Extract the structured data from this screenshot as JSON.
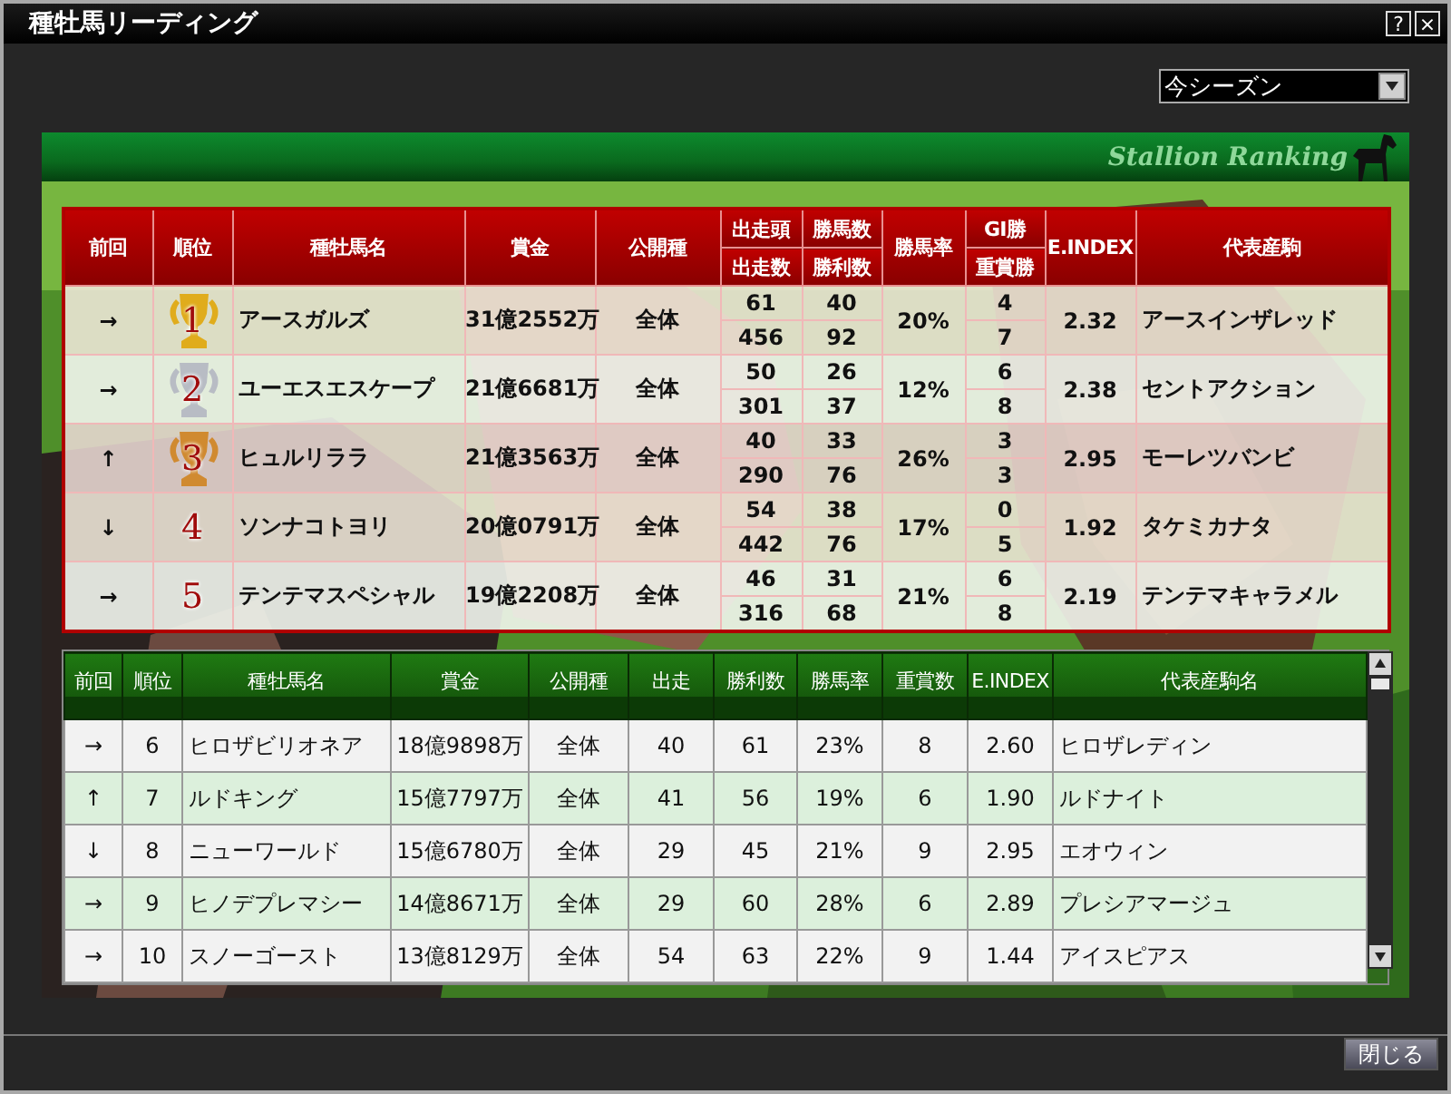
{
  "window": {
    "title": "種牡馬リーディング",
    "help": "?",
    "close": "×"
  },
  "season_select": {
    "value": "今シーズン"
  },
  "banner": {
    "title": "Stallion Ranking"
  },
  "top_table": {
    "columns": [
      {
        "label": "前回"
      },
      {
        "label": "順位"
      },
      {
        "label": "種牡馬名"
      },
      {
        "label": "賞金"
      },
      {
        "label": "公開種"
      },
      {
        "label": "出走頭",
        "sub": "出走数"
      },
      {
        "label": "勝馬数",
        "sub": "勝利数"
      },
      {
        "label": "勝馬率"
      },
      {
        "label": "GI勝",
        "sub": "重賞勝"
      },
      {
        "label": "E.INDEX"
      },
      {
        "label": "代表産駒"
      }
    ],
    "rows": [
      {
        "trend": "→",
        "rank": "1",
        "color": "#e0ac1c",
        "name": "アースガルズ",
        "prize": "31億2552万",
        "type": "全体",
        "starters": "61",
        "runs": "456",
        "winners": "40",
        "wins": "92",
        "win_rate": "20%",
        "g1_wins": "4",
        "graded_wins": "7",
        "e_index": "2.32",
        "top_foal": "アースインザレッド"
      },
      {
        "trend": "→",
        "rank": "2",
        "color": "#b8bcc4",
        "name": "ユーエスエスケープ",
        "prize": "21億6681万",
        "type": "全体",
        "starters": "50",
        "runs": "301",
        "winners": "26",
        "wins": "37",
        "win_rate": "12%",
        "g1_wins": "6",
        "graded_wins": "8",
        "e_index": "2.38",
        "top_foal": "セントアクション"
      },
      {
        "trend": "↑",
        "rank": "3",
        "color": "#d08a30",
        "name": "ヒュルリララ",
        "prize": "21億3563万",
        "type": "全体",
        "starters": "40",
        "runs": "290",
        "winners": "33",
        "wins": "76",
        "win_rate": "26%",
        "g1_wins": "3",
        "graded_wins": "3",
        "e_index": "2.95",
        "top_foal": "モーレツバンビ"
      },
      {
        "trend": "↓",
        "rank": "4",
        "name": "ソンナコトヨリ",
        "prize": "20億0791万",
        "type": "全体",
        "starters": "54",
        "runs": "442",
        "winners": "38",
        "wins": "76",
        "win_rate": "17%",
        "g1_wins": "0",
        "graded_wins": "5",
        "e_index": "1.92",
        "top_foal": "タケミカナタ"
      },
      {
        "trend": "→",
        "rank": "5",
        "name": "テンテマスペシャル",
        "prize": "19億2208万",
        "type": "全体",
        "starters": "46",
        "runs": "316",
        "winners": "31",
        "wins": "68",
        "win_rate": "21%",
        "g1_wins": "6",
        "graded_wins": "8",
        "e_index": "2.19",
        "top_foal": "テンテマキャラメル"
      }
    ]
  },
  "bottom_table": {
    "columns": [
      "前回",
      "順位",
      "種牡馬名",
      "賞金",
      "公開種",
      "出走",
      "勝利数",
      "勝馬率",
      "重賞数",
      "E.INDEX",
      "代表産駒名"
    ],
    "rows": [
      [
        "→",
        "6",
        "ヒロザビリオネア",
        "18億9898万",
        "全体",
        "40",
        "61",
        "23%",
        "8",
        "2.60",
        "ヒロザレディン"
      ],
      [
        "↑",
        "7",
        "ルドキング",
        "15億7797万",
        "全体",
        "41",
        "56",
        "19%",
        "6",
        "1.90",
        "ルドナイト"
      ],
      [
        "↓",
        "8",
        "ニューワールド",
        "15億6780万",
        "全体",
        "29",
        "45",
        "21%",
        "9",
        "2.95",
        "エオウィン"
      ],
      [
        "→",
        "9",
        "ヒノデプレマシー",
        "14億8671万",
        "全体",
        "29",
        "60",
        "28%",
        "6",
        "2.89",
        "プレシアマージュ"
      ],
      [
        "→",
        "10",
        "スノーゴースト",
        "13億8129万",
        "全体",
        "54",
        "63",
        "22%",
        "9",
        "1.44",
        "アイスピアス"
      ]
    ]
  },
  "close_button": "閉じる"
}
